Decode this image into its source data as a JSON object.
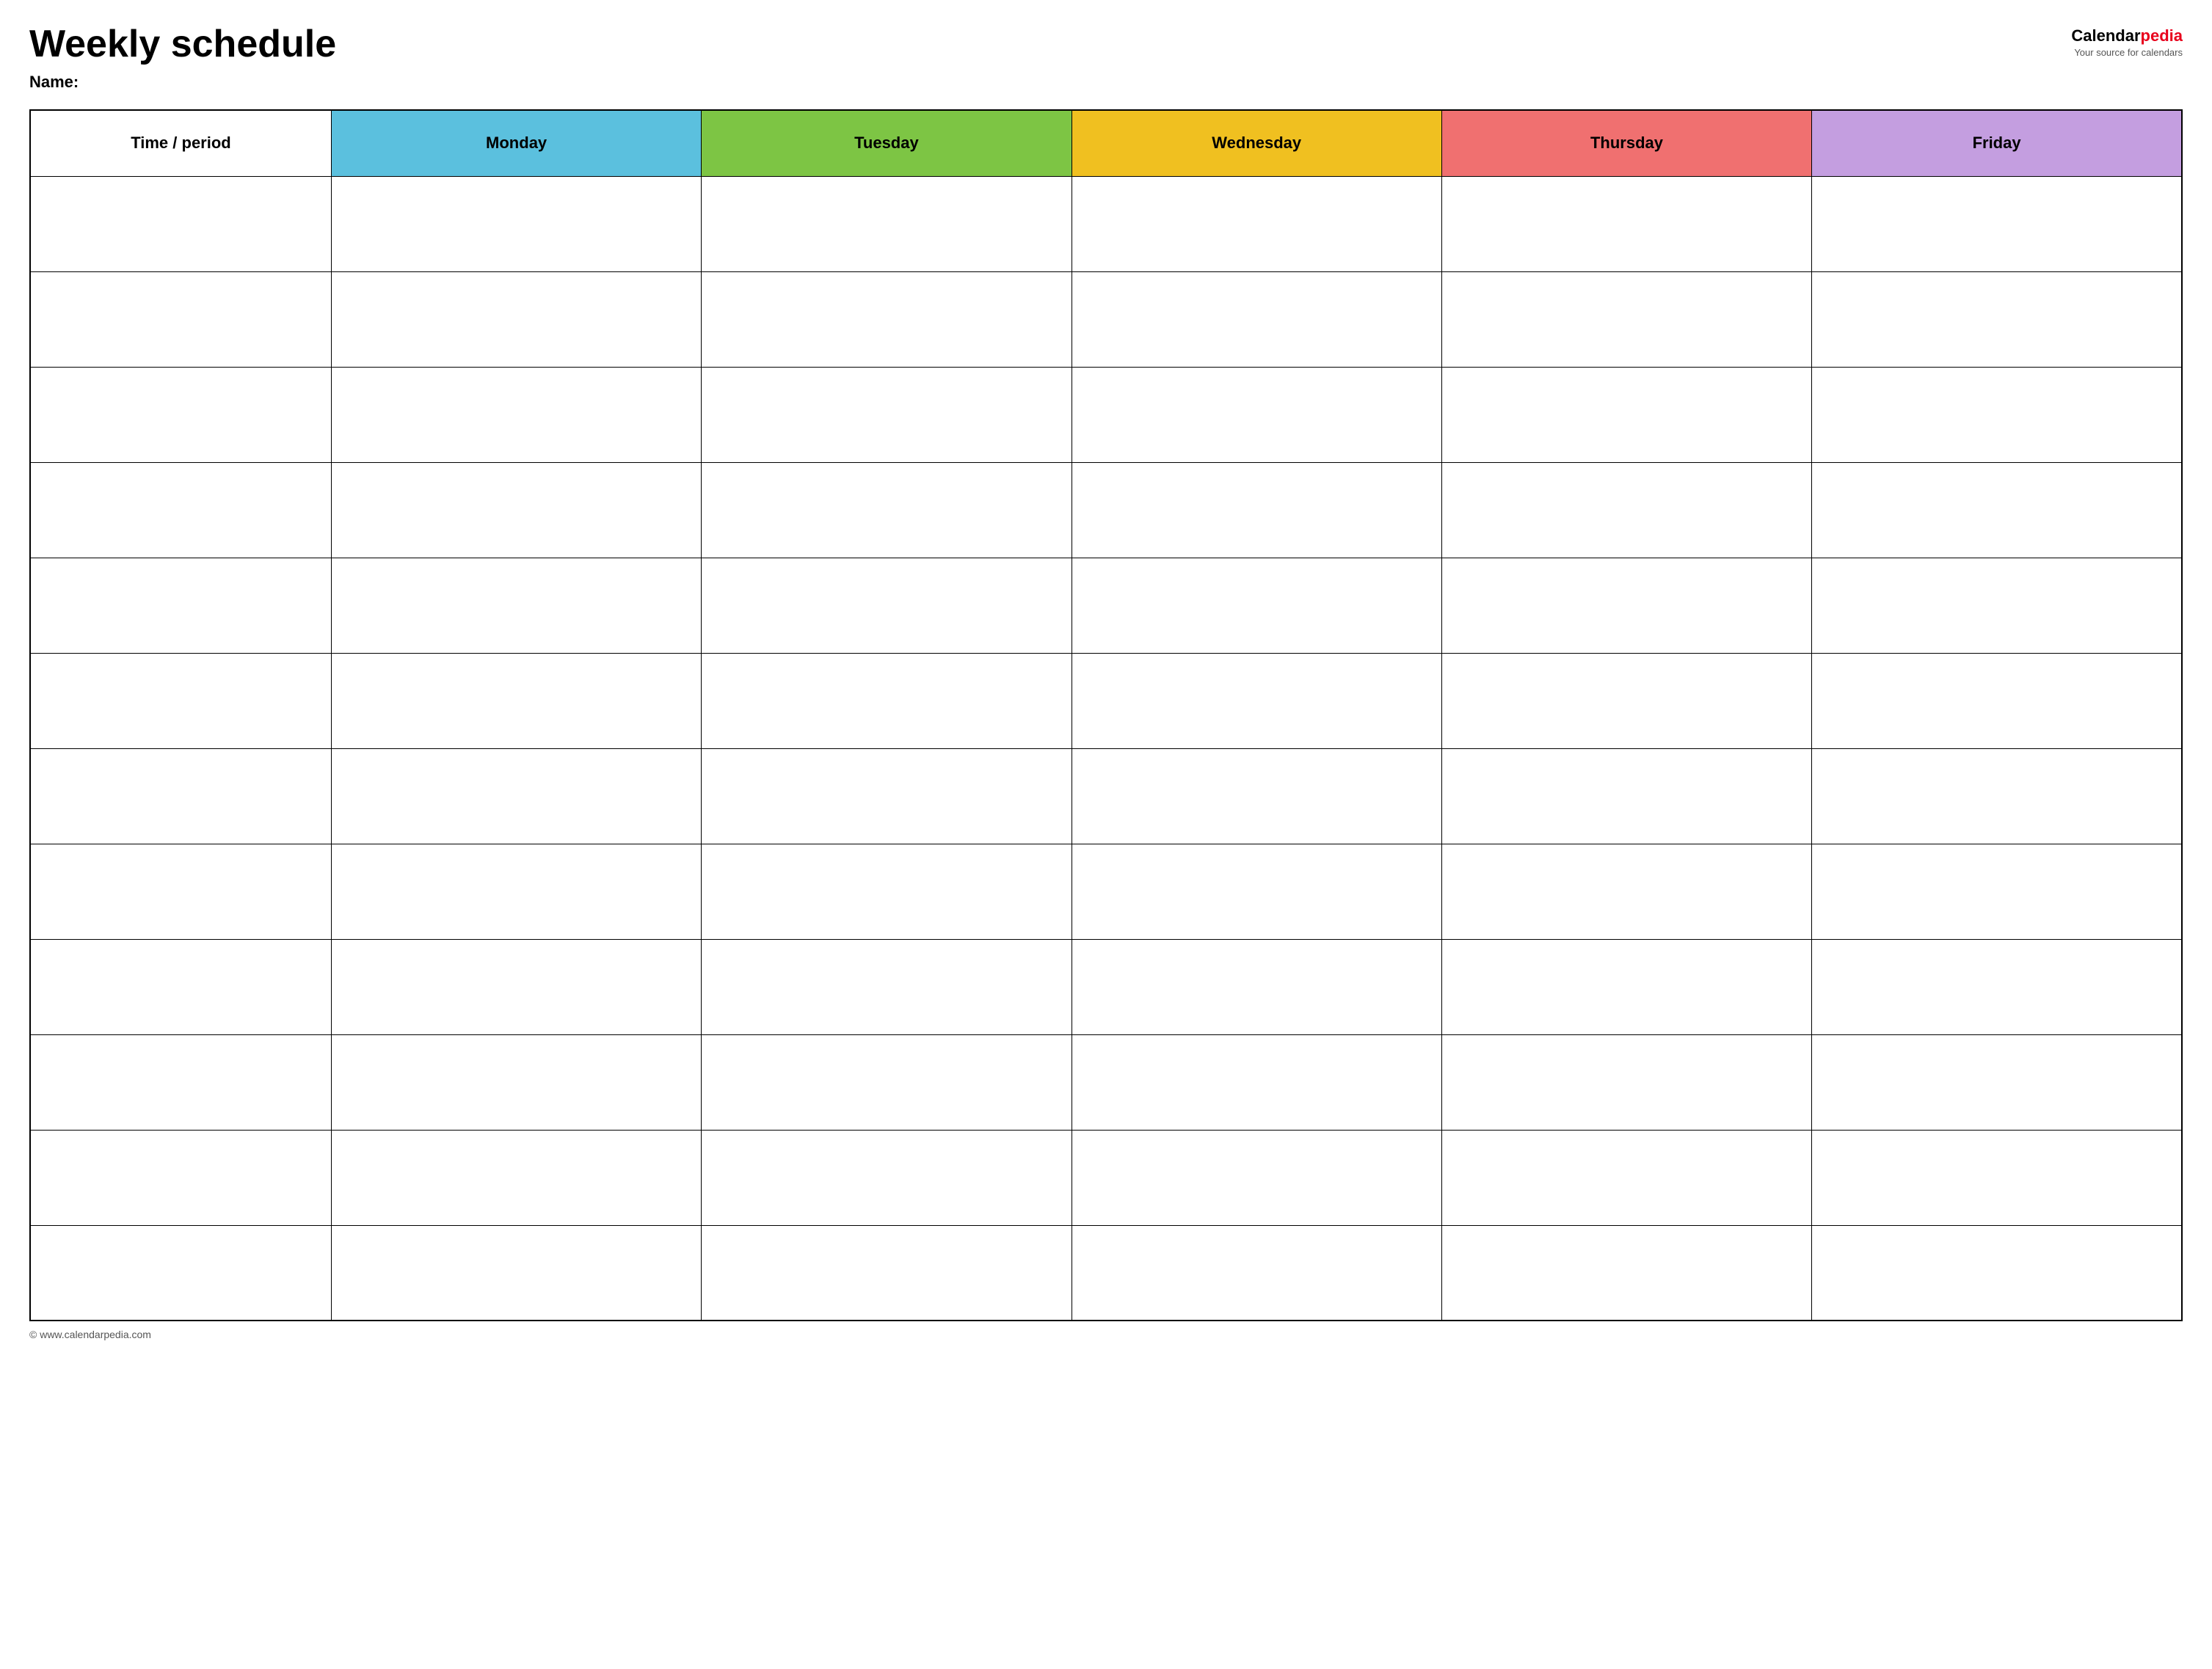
{
  "header": {
    "title": "Weekly schedule",
    "name_label": "Name:",
    "logo": {
      "calendar_text": "Calendar",
      "pedia_text": "pedia",
      "tagline": "Your source for calendars"
    }
  },
  "table": {
    "headers": [
      {
        "id": "time",
        "label": "Time / period",
        "color": "#ffffff"
      },
      {
        "id": "monday",
        "label": "Monday",
        "color": "#5bc0de"
      },
      {
        "id": "tuesday",
        "label": "Tuesday",
        "color": "#7dc544"
      },
      {
        "id": "wednesday",
        "label": "Wednesday",
        "color": "#f0c020"
      },
      {
        "id": "thursday",
        "label": "Thursday",
        "color": "#f07070"
      },
      {
        "id": "friday",
        "label": "Friday",
        "color": "#c49ee0"
      }
    ],
    "row_count": 12
  },
  "footer": {
    "url": "© www.calendarpedia.com"
  }
}
